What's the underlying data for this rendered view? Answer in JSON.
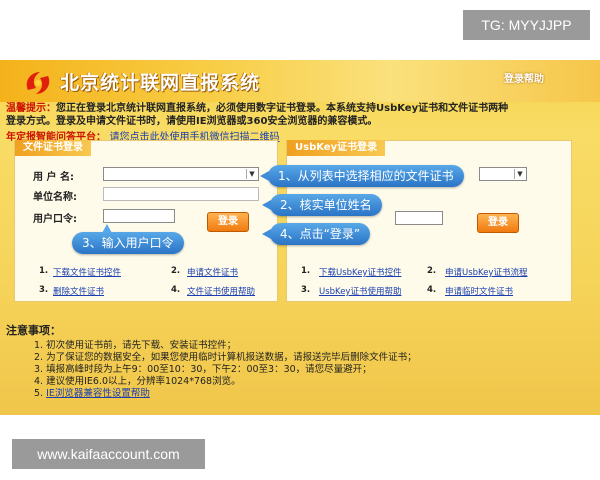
{
  "watermark_top": "TG: MYYJJPP",
  "watermark_bottom": "www.kaifaaccount.com",
  "header": {
    "title": "北京统计联网直报系统",
    "login_help": "登录帮助"
  },
  "notice": {
    "label": "温馨提示：",
    "line1": "您正在登录北京统计联网直报系统，必须使用数字证书登录。本系统支持UsbKey证书和文件证书两种",
    "line2": "登录方式。登录及申请文件证书时，请使用IE浏览器或360安全浏览器的兼容模式。"
  },
  "help_row": {
    "label": "年定报智能问答平台：",
    "link": "请您点击此处使用手机微信扫描二维码"
  },
  "file_cert_panel": {
    "title": "文件证书登录",
    "user_label": "用 户 名:",
    "unit_label": "单位名称:",
    "password_label": "用户口令:",
    "login_button": "登录",
    "links": [
      {
        "num": "1.",
        "text": "下载文件证书控件"
      },
      {
        "num": "2.",
        "text": "申请文件证书"
      },
      {
        "num": "3.",
        "text": "删除文件证书"
      },
      {
        "num": "4.",
        "text": "文件证书使用帮助"
      }
    ]
  },
  "usbkey_panel": {
    "title": "UsbKey证书登录",
    "login_button": "登录",
    "links": [
      {
        "num": "1.",
        "text": "下载UsbKey证书控件"
      },
      {
        "num": "2.",
        "text": "申请UsbKey证书流程"
      },
      {
        "num": "3.",
        "text": "UsbKey证书使用帮助"
      },
      {
        "num": "4.",
        "text": "申请临时文件证书"
      }
    ]
  },
  "callouts": {
    "step1": "1、从列表中选择相应的文件证书",
    "step2": "2、核实单位姓名",
    "step3": "3、输入用户口令",
    "step4": "4、点击“登录”"
  },
  "notes": {
    "title": "注意事项：",
    "items": [
      {
        "num": "1.",
        "text": "初次使用证书前，请先下载、安装证书控件；"
      },
      {
        "num": "2.",
        "text": "为了保证您的数据安全，如果您使用临时计算机报送数据，请报送完毕后删除文件证书；"
      },
      {
        "num": "3.",
        "text": "填报高峰时段为上午9：00至10：30，下午2：00至3：30，请您尽量避开；"
      },
      {
        "num": "4.",
        "text": "建议使用IE6.0以上，分辨率1024*768浏览。"
      },
      {
        "num": "5.",
        "text": "IE浏览器兼容性设置帮助"
      }
    ]
  },
  "colors": {
    "accent_orange": "#f07a10",
    "callout_blue": "#2b74c6",
    "link_blue": "#1a3fb0",
    "notice_red": "#cc1100"
  }
}
